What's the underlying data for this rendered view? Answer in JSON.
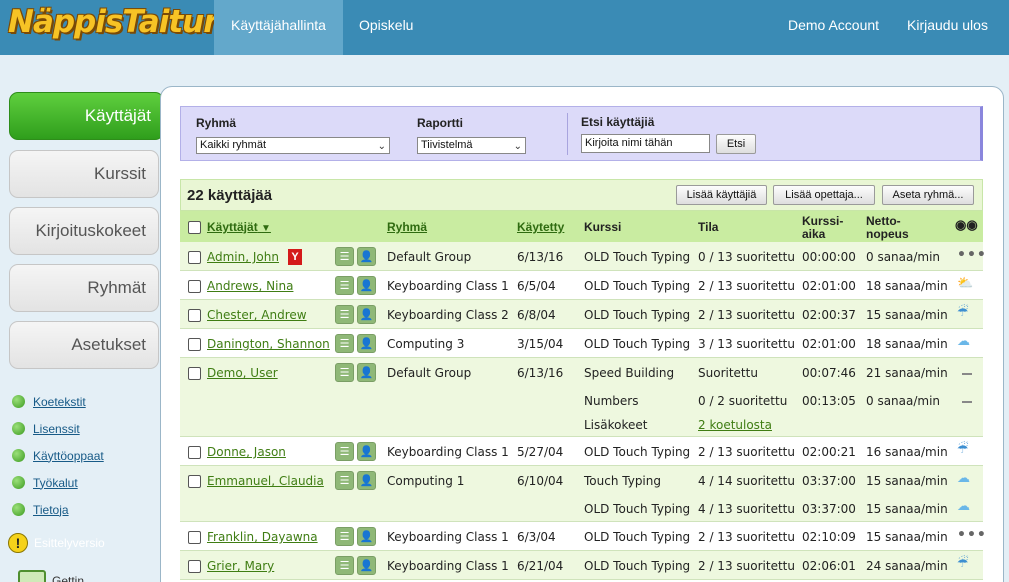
{
  "app": {
    "logo": "NäppisTaituri"
  },
  "nav": {
    "kayttajahallinta": "Käyttäjähallinta",
    "opiskelu": "Opiskelu",
    "demo_account": "Demo Account",
    "logout": "Kirjaudu ulos"
  },
  "sidebar": {
    "buttons": [
      "Käyttäjät",
      "Kurssit",
      "Kirjoituskokeet",
      "Ryhmät",
      "Asetukset"
    ],
    "links": [
      "Koetekstit",
      "Lisenssit",
      "Käyttöoppaat",
      "Työkalut",
      "Tietoja"
    ],
    "demo_note": "Esittelyversio",
    "extra_label": "Gettin..."
  },
  "filter": {
    "group_label": "Ryhmä",
    "group_value": "Kaikki ryhmät",
    "report_label": "Raportti",
    "report_value": "Tiivistelmä",
    "search_label": "Etsi käyttäjiä",
    "search_placeholder": "Kirjoita nimi tähän",
    "search_button": "Etsi"
  },
  "toolbar": {
    "count": "22 käyttäjää",
    "add_user": "Lisää käyttäjiä",
    "add_teacher": "Lisää opettaja...",
    "set_group": "Aseta ryhmä..."
  },
  "columns": {
    "users": "Käyttäjät",
    "group": "Ryhmä",
    "used": "Käytetty",
    "course": "Kurssi",
    "status": "Tila",
    "course_time_1": "Kurssi-",
    "course_time_2": "aika",
    "net_speed_1": "Netto-",
    "net_speed_2": "nopeus"
  },
  "rows": [
    {
      "name": "Admin, John",
      "badge": "Y",
      "group": "Default Group",
      "date": "6/13/16",
      "lines": [
        {
          "course": "OLD Touch Typing",
          "status": "0 / 13 suoritettu",
          "time": "00:00:00",
          "speed": "0 sanaa/min",
          "icon": "dots-icon"
        }
      ]
    },
    {
      "name": "Andrews, Nina",
      "group": "Keyboarding Class 1",
      "date": "6/5/04",
      "lines": [
        {
          "course": "OLD Touch Typing",
          "status": "2 / 13 suoritettu",
          "time": "02:01:00",
          "speed": "18 sanaa/min",
          "icon": "sun-cloud-icon"
        }
      ]
    },
    {
      "name": "Chester, Andrew",
      "group": "Keyboarding Class 2",
      "date": "6/8/04",
      "lines": [
        {
          "course": "OLD Touch Typing",
          "status": "2 / 13 suoritettu",
          "time": "02:00:37",
          "speed": "15 sanaa/min",
          "icon": "rain-icon"
        }
      ]
    },
    {
      "name": "Danington, Shannon",
      "group": "Computing 3",
      "date": "3/15/04",
      "lines": [
        {
          "course": "OLD Touch Typing",
          "status": "3 / 13 suoritettu",
          "time": "02:01:00",
          "speed": "18 sanaa/min",
          "icon": "cloud-icon"
        }
      ]
    },
    {
      "name": "Demo, User",
      "group": "Default Group",
      "date": "6/13/16",
      "lines": [
        {
          "course": "Speed Building",
          "status": "Suoritettu",
          "time": "00:07:46",
          "speed": "21 sanaa/min",
          "icon": "dash-icon"
        },
        {
          "course": "Numbers",
          "status": "0 / 2 suoritettu",
          "time": "00:13:05",
          "speed": "0 sanaa/min",
          "icon": "dash-icon"
        },
        {
          "course": "Lisäkokeet",
          "status": "2 koetulosta",
          "status_link": true,
          "time": "",
          "speed": "",
          "icon": ""
        }
      ]
    },
    {
      "name": "Donne, Jason",
      "group": "Keyboarding Class 1",
      "date": "5/27/04",
      "lines": [
        {
          "course": "OLD Touch Typing",
          "status": "2 / 13 suoritettu",
          "time": "02:00:21",
          "speed": "16 sanaa/min",
          "icon": "rain-icon"
        }
      ]
    },
    {
      "name": "Emmanuel, Claudia",
      "group": "Computing 1",
      "date": "6/10/04",
      "lines": [
        {
          "course": "Touch Typing",
          "status": "4 / 14 suoritettu",
          "time": "03:37:00",
          "speed": "15 sanaa/min",
          "icon": "cloud-icon"
        },
        {
          "course": "OLD Touch Typing",
          "status": "4 / 13 suoritettu",
          "time": "03:37:00",
          "speed": "15 sanaa/min",
          "icon": "cloud-icon"
        }
      ]
    },
    {
      "name": "Franklin, Dayawna",
      "group": "Keyboarding Class 1",
      "date": "6/3/04",
      "lines": [
        {
          "course": "OLD Touch Typing",
          "status": "2 / 13 suoritettu",
          "time": "02:10:09",
          "speed": "15 sanaa/min",
          "icon": "dots-icon"
        }
      ]
    },
    {
      "name": "Grier, Mary",
      "group": "Keyboarding Class 1",
      "date": "6/21/04",
      "lines": [
        {
          "course": "OLD Touch Typing",
          "status": "2 / 13 suoritettu",
          "time": "02:06:01",
          "speed": "24 sanaa/min",
          "icon": "rain-icon"
        }
      ]
    }
  ],
  "colors": {
    "topbar": "#3a8bb5",
    "accent_green": "#3f7d13",
    "header_green": "#c9eca1"
  }
}
